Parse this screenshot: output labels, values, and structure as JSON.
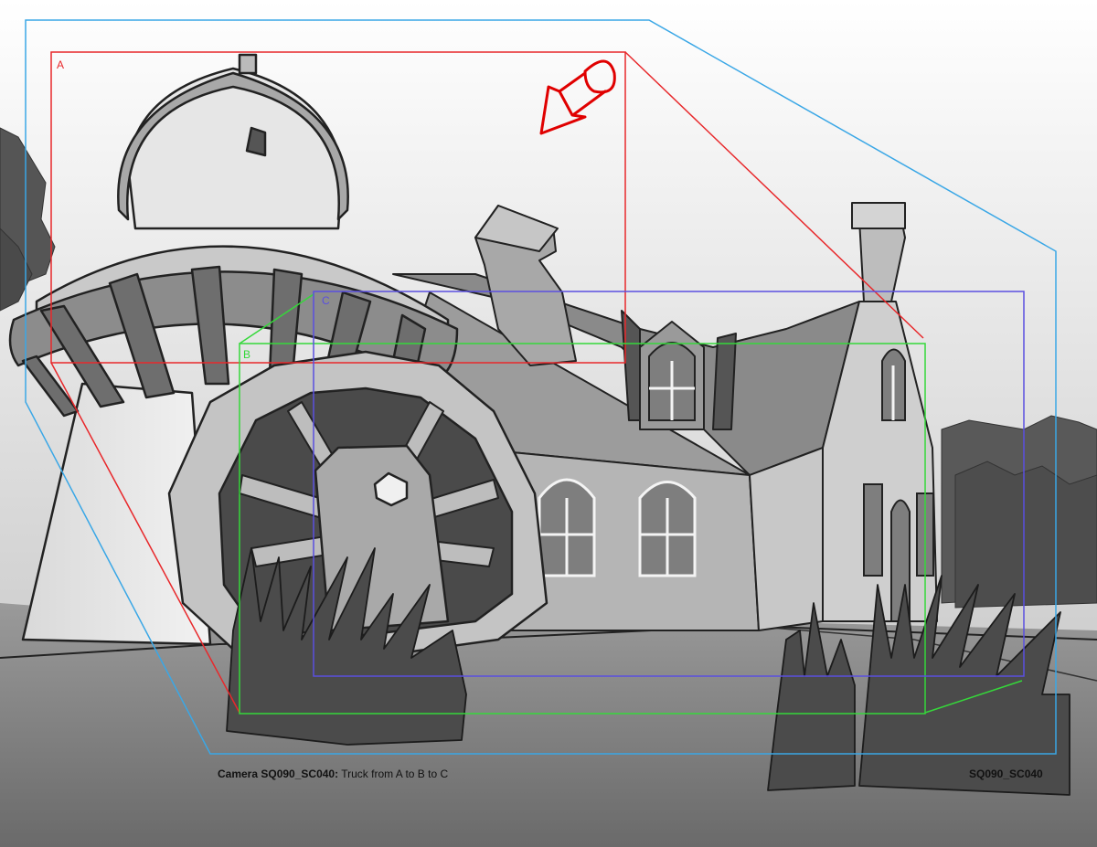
{
  "frame_labels": {
    "a": "A",
    "b": "B",
    "c": "C"
  },
  "caption": {
    "camera_name": "Camera SQ090_SC040:",
    "description": "Truck from A to B to C",
    "shot_code": "SQ090_SC040"
  },
  "colors": {
    "frame_a": "#e8282b",
    "frame_b": "#35d83a",
    "frame_c": "#5a4fe0",
    "outer_frame": "#3aa7e6",
    "arrow": "#e00000"
  },
  "icons": [
    "camera-move-arrow-icon"
  ]
}
